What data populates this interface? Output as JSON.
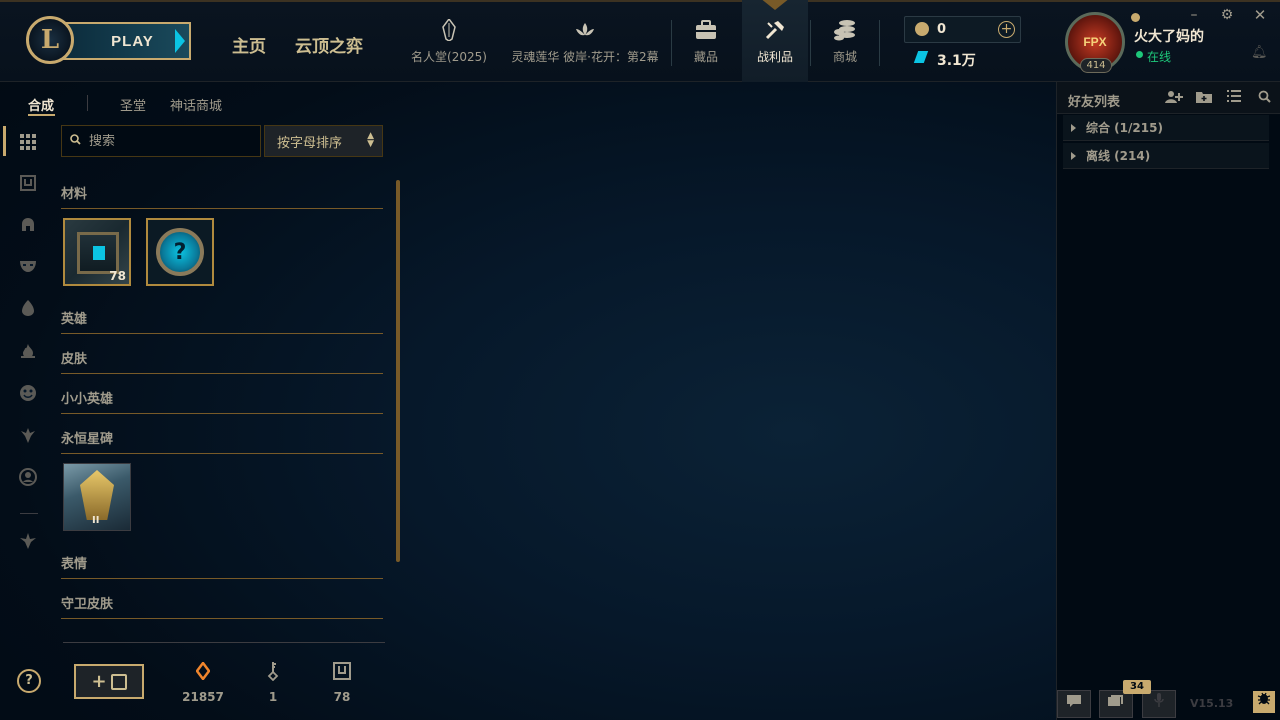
{
  "header": {
    "logo_letter": "L",
    "play_label": "PLAY",
    "nav_home": "主页",
    "nav_tft": "云顶之弈",
    "nav_hall": "名人堂(2025)",
    "nav_event": "灵魂莲华 彼岸·花开：第2幕",
    "nav_collection": "藏品",
    "nav_loot": "战利品",
    "nav_store": "商城",
    "currency_rp": "0",
    "currency_be": "3.1万",
    "profile_name": "火大了妈的",
    "profile_status": "在线",
    "profile_level": "414",
    "profile_icon_text": "FPX"
  },
  "subtabs": {
    "craft": "合成",
    "sanctum": "圣堂",
    "mythic_shop": "神话商城"
  },
  "loot": {
    "search_placeholder": "搜索",
    "sort_label": "按字母排序",
    "categories": {
      "materials": "材料",
      "champions": "英雄",
      "skins": "皮肤",
      "little_legends": "小小英雄",
      "eternals": "永恒星碑",
      "emotes": "表情",
      "ward_skins": "守卫皮肤"
    },
    "chest_count": "78",
    "mystery_symbol": "?",
    "ward_tier": "II",
    "add_chest_symbol": "+",
    "essence_total": "21857",
    "keys_total": "1",
    "chests_total": "78"
  },
  "friends": {
    "title": "好友列表",
    "group_general": "综合 (1/215)",
    "group_offline": "离线 (214)",
    "news_badge": "34",
    "version": "V15.13"
  },
  "colors": {
    "gold": "#c8aa6e",
    "online_green": "#1ec77a",
    "hextech_blue": "#0bc4e3",
    "essence_orange": "#f0852c"
  },
  "icons": {
    "logo": "league-logo-icon",
    "hall": "crystal-icon",
    "event": "lotus-icon",
    "collection": "backpack-icon",
    "loot": "crafting-icon",
    "store": "coins-icon"
  }
}
